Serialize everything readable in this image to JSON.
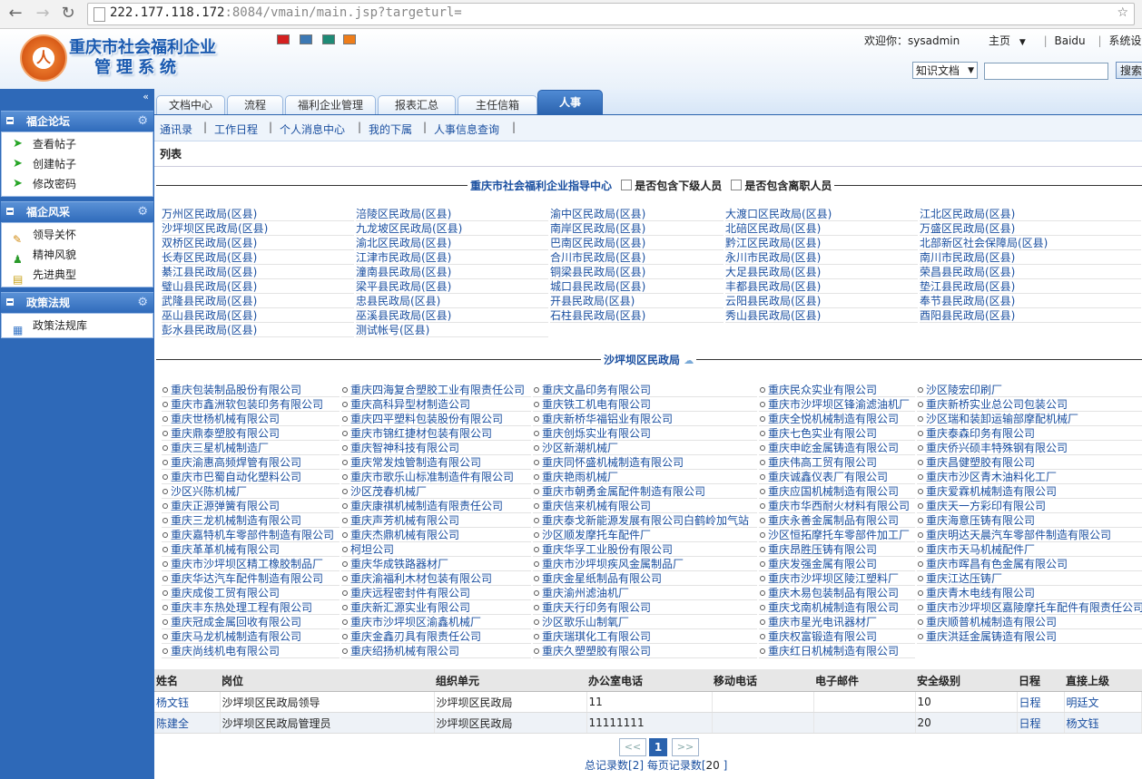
{
  "browser": {
    "url_host": "222.177.118.172",
    "url_rest": ":8084/vmain/main.jsp?targeturl="
  },
  "header": {
    "logo_line1": "重庆市社会福利企业",
    "logo_line2": "管理系统",
    "theme_colors": [
      "#d42020",
      "#3c78b4",
      "#1e8a76",
      "#ee7d1a"
    ],
    "welcome": "欢迎你：sysadmin",
    "home": "主页",
    "baidu": "Baidu",
    "settings": "系统设置",
    "cut": "退",
    "search_scope": "知识文档",
    "search_button": "搜索"
  },
  "sidebar": {
    "collapse": "«",
    "sections": [
      {
        "title": "福企论坛",
        "items": [
          "查看帖子",
          "创建帖子",
          "修改密码"
        ]
      },
      {
        "title": "福企风采",
        "items": [
          "领导关怀",
          "精神风貌",
          "先进典型"
        ]
      },
      {
        "title": "政策法规",
        "items": [
          "政策法规库"
        ]
      }
    ]
  },
  "tabs": [
    "文档中心",
    "流程",
    "福利企业管理",
    "报表汇总",
    "主任信箱",
    "人事"
  ],
  "subnav": [
    "通讯录",
    "工作日程",
    "个人消息中心",
    "我的下属",
    "人事信息查询"
  ],
  "list_title": "列表",
  "org_section": {
    "legend": "重庆市社会福利企业指导中心",
    "opt1": "是否包含下级人员",
    "opt2": "是否包含离职人员",
    "bureaus": [
      "万州区民政局(区县)",
      "涪陵区民政局(区县)",
      "渝中区民政局(区县)",
      "大渡口区民政局(区县)",
      "江北区民政局(区县)",
      "沙坪坝区民政局(区县)",
      "九龙坡区民政局(区县)",
      "南岸区民政局(区县)",
      "北碚区民政局(区县)",
      "万盛区民政局(区县)",
      "双桥区民政局(区县)",
      "渝北区民政局(区县)",
      "巴南区民政局(区县)",
      "黔江区民政局(区县)",
      "北部新区社会保障局(区县)",
      "长寿区民政局(区县)",
      "江津市民政局(区县)",
      "合川市民政局(区县)",
      "永川市民政局(区县)",
      "南川市民政局(区县)",
      "綦江县民政局(区县)",
      "潼南县民政局(区县)",
      "铜梁县民政局(区县)",
      "大足县民政局(区县)",
      "荣昌县民政局(区县)",
      "璧山县民政局(区县)",
      "梁平县民政局(区县)",
      "城口县民政局(区县)",
      "丰都县民政局(区县)",
      "垫江县民政局(区县)",
      "武隆县民政局(区县)",
      "忠县民政局(区县)",
      "开县民政局(区县)",
      "云阳县民政局(区县)",
      "奉节县民政局(区县)",
      "巫山县民政局(区县)",
      "巫溪县民政局(区县)",
      "石柱县民政局(区县)",
      "秀山县民政局(区县)",
      "酉阳县民政局(区县)",
      "彭水县民政局(区县)",
      "测试帐号(区县)"
    ]
  },
  "company_section": {
    "legend": "沙坪坝区民政局",
    "companies": [
      "重庆包装制品股份有限公司",
      "重庆四海复合塑胶工业有限责任公司",
      "重庆文晶印务有限公司",
      "重庆民众实业有限公司",
      "沙区陵宏印刷厂",
      "重庆市鑫洲软包装印务有限公司",
      "重庆高科异型材制造公司",
      "重庆铁工机电有限公司",
      "重庆市沙坪坝区锋渝滤油机厂",
      "重庆新桥实业总公司包装公司",
      "重庆世杨机械有限公司",
      "重庆四平塑料包装股份有限公司",
      "重庆新桥华福铝业有限公司",
      "重庆全悦机械制造有限公司",
      "沙区瑞和装卸运输部摩配机械厂",
      "重庆鼎泰塑胶有限公司",
      "重庆市锦红捷材包装有限公司",
      "重庆创烁实业有限公司",
      "重庆七色实业有限公司",
      "重庆泰森印务有限公司",
      "重庆三星机械制造厂",
      "重庆智神科技有限公司",
      "沙区新潮机械厂",
      "重庆申屹金属铸造有限公司",
      "重庆侨兴硕丰特殊钢有限公司",
      "重庆渝惠高频焊管有限公司",
      "重庆常发烛管制造有限公司",
      "重庆同怀盛机械制造有限公司",
      "重庆伟高工贸有限公司",
      "重庆昌健塑胶有限公司",
      "重庆市巴蜀自动化塑料公司",
      "重庆市歌乐山标准制造件有限公司",
      "重庆艳雨机械厂",
      "重庆诚鑫仪表厂有限公司",
      "重庆市沙区青木油料化工厂",
      "沙区兴陈机械厂",
      "沙区茂春机械厂",
      "重庆市朝勇金属配件制造有限公司",
      "重庆应国机械制造有限公司",
      "重庆爱霖机械制造有限公司",
      "重庆正源弹簧有限公司",
      "重庆康祺机械制造有限责任公司",
      "重庆信来机械有限公司",
      "重庆市华西耐火材料有限公司",
      "重庆天一方彩印有限公司",
      "重庆三龙机械制造有限公司",
      "重庆声芳机械有限公司",
      "重庆泰戈新能源发展有限公司白鹤岭加气站",
      "重庆永善金属制品有限公司",
      "重庆海意压铸有限公司",
      "重庆嘉特机车零部件制造有限公司",
      "重庆杰鼎机械有限公司",
      "沙区顺发摩托车配件厂",
      "沙区恒拓摩托车零部件加工厂",
      "重庆明达天晨汽车零部件制造有限公司",
      "重庆革革机械有限公司",
      "柯坦公司",
      "重庆华孚工业股份有限公司",
      "重庆昂胜压铸有限公司",
      "重庆市天马机械配件厂",
      "重庆市沙坪坝区精工橡胶制品厂",
      "重庆华成铁路器材厂",
      "重庆市沙坪坝疾风金属制品厂",
      "重庆发强金属有限公司",
      "重庆市晖昌有色金属有限公司",
      "重庆华达汽车配件制造有限公司",
      "重庆渝福利木材包装有限公司",
      "重庆金星纸制品有限公司",
      "重庆市沙坪坝区陵江塑料厂",
      "重庆江达压铸厂",
      "重庆成俊工贸有限公司",
      "重庆远程密封件有限公司",
      "重庆渝州滤油机厂",
      "重庆木易包装制品有限公司",
      "重庆青木电线有限公司",
      "重庆丰东热处理工程有限公司",
      "重庆新汇源实业有限公司",
      "重庆天行印务有限公司",
      "重庆戈南机械制造有限公司",
      "重庆市沙坪坝区嘉陵摩托车配件有限责任公司",
      "重庆冠成金属回收有限公司",
      "重庆市沙坪坝区渝鑫机械厂",
      "沙区歌乐山制氧厂",
      "重庆市星光电讯器材厂",
      "重庆顺普机械制造有限公司",
      "重庆马龙机械制造有限公司",
      "重庆金鑫刃具有限责任公司",
      "重庆瑞琪化工有限公司",
      "重庆权富锻造有限公司",
      "重庆洪廷金属铸造有限公司",
      "重庆尚线机电有限公司",
      "重庆绍扬机械有限公司",
      "重庆久塑塑胶有限公司",
      "重庆红日机械制造有限公司"
    ]
  },
  "table": {
    "headers": [
      "姓名",
      "岗位",
      "组织单元",
      "办公室电话",
      "移动电话",
      "电子邮件",
      "安全级别",
      "日程",
      "直接上级"
    ],
    "rows": [
      [
        "杨文钰",
        "沙坪坝区民政局领导",
        "沙坪坝区民政局",
        "11",
        "",
        "",
        "10",
        "日程",
        "明廷文"
      ],
      [
        "陈建全",
        "沙坪坝区民政局管理员",
        "沙坪坝区民政局",
        "11111111",
        "",
        "",
        "20",
        "日程",
        "杨文钰"
      ]
    ]
  },
  "pager": {
    "prev": "<<",
    "current": "1",
    "next": ">>",
    "total_label": "总记录数[",
    "total": "2",
    "per_label": "] 每页记录数[",
    "per": "20",
    "end": "  ]"
  }
}
